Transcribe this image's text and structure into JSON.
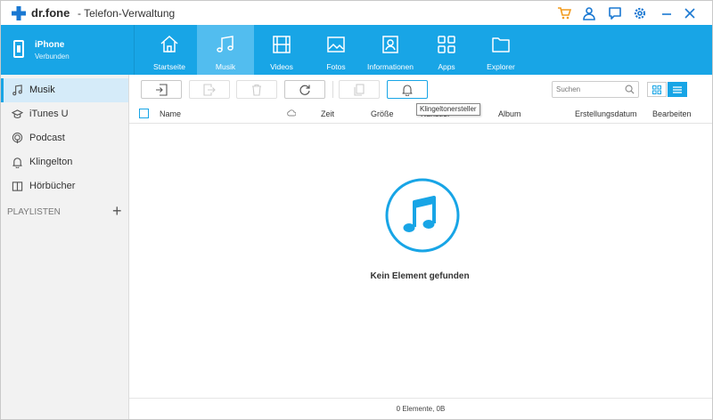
{
  "app": {
    "brand": "dr.fone",
    "title": "- Telefon-Verwaltung"
  },
  "colors": {
    "accent": "#18a5e6",
    "brand_plus": "#1a78d2",
    "cart": "#f29b1d"
  },
  "device": {
    "name": "iPhone",
    "status": "Verbunden"
  },
  "nav_tabs": [
    {
      "label": "Startseite",
      "icon": "home-icon"
    },
    {
      "label": "Musik",
      "icon": "music-icon",
      "active": true
    },
    {
      "label": "Videos",
      "icon": "film-icon"
    },
    {
      "label": "Fotos",
      "icon": "photo-icon"
    },
    {
      "label": "Informationen",
      "icon": "contact-icon"
    },
    {
      "label": "Apps",
      "icon": "apps-icon"
    },
    {
      "label": "Explorer",
      "icon": "folder-icon"
    }
  ],
  "sidebar": {
    "items": [
      {
        "label": "Musik",
        "icon": "music-note-icon",
        "active": true
      },
      {
        "label": "iTunes U",
        "icon": "graduation-cap-icon"
      },
      {
        "label": "Podcast",
        "icon": "podcast-icon"
      },
      {
        "label": "Klingelton",
        "icon": "bell-icon"
      },
      {
        "label": "Hörbücher",
        "icon": "audiobook-icon"
      }
    ],
    "playlists_label": "PLAYLISTEN",
    "add_label": "+"
  },
  "toolbar": {
    "tooltip": "Klingeltonersteller",
    "search_placeholder": "Suchen"
  },
  "table": {
    "columns": [
      "Name",
      "Zeit",
      "Größe",
      "Künstler",
      "Album",
      "Erstellungsdatum",
      "Bearbeiten"
    ]
  },
  "empty": {
    "message": "Kein Element gefunden"
  },
  "status": {
    "text": "0 Elemente, 0B"
  }
}
